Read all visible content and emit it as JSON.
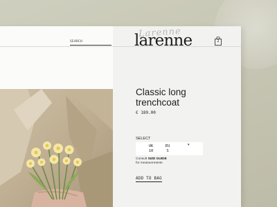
{
  "header": {
    "search_label": "SEARCH",
    "logo": "larenne",
    "logo_script": "Larenne",
    "bag_count": "2"
  },
  "product": {
    "title_line1": "Classic long",
    "title_line2": "trenchcoat",
    "price": "€ 189.00",
    "select_label": "SELECT",
    "sizes": [
      {
        "region": "UK",
        "value": "10"
      },
      {
        "region": "EU",
        "value": "S"
      }
    ],
    "consult_prefix": "Consult ",
    "size_guide": "SIZE GUIDE",
    "consult_suffix": "for measurements",
    "add_to_bag": "ADD TO BAG"
  },
  "colors": {
    "backdrop": "#c9c8b6",
    "card": "#f2f2f0",
    "text": "#1e1e1e"
  }
}
